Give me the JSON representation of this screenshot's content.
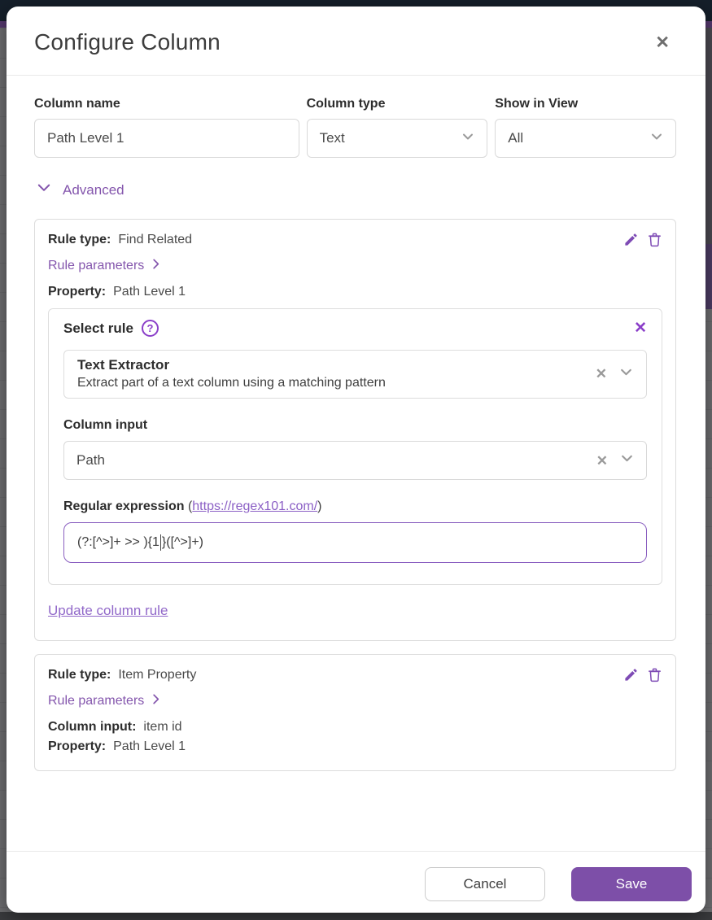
{
  "modal": {
    "title": "Configure Column"
  },
  "icons": {
    "close": "✕",
    "clear": "✕",
    "help": "?"
  },
  "fields": {
    "column_name": {
      "label": "Column name",
      "value": "Path Level 1"
    },
    "column_type": {
      "label": "Column type",
      "value": "Text"
    },
    "show_in_view": {
      "label": "Show in View",
      "value": "All"
    }
  },
  "advanced": {
    "label": "Advanced"
  },
  "rules": [
    {
      "rule_type_label": "Rule type:",
      "rule_type_value": "Find Related",
      "rule_parameters_label": "Rule parameters",
      "property_label": "Property:",
      "property_value": "Path Level 1"
    },
    {
      "rule_type_label": "Rule type:",
      "rule_type_value": "Item Property",
      "rule_parameters_label": "Rule parameters",
      "column_input_label": "Column input:",
      "column_input_value": "item id",
      "property_label": "Property:",
      "property_value": "Path Level 1"
    }
  ],
  "rule_editor": {
    "title": "Select rule",
    "selected_rule": {
      "name": "Text Extractor",
      "description": "Extract part of a text column using a matching pattern"
    },
    "column_input": {
      "label": "Column input",
      "value": "Path"
    },
    "regex": {
      "label": "Regular expression",
      "link_prefix": "(",
      "link": "https://regex101.com/",
      "link_suffix": ")",
      "value_before_caret": "(?:[^>]+ >> ){1",
      "value_after_caret": "}([^>]+)"
    },
    "update_link": "Update column rule"
  },
  "footer": {
    "cancel": "Cancel",
    "save": "Save"
  },
  "colors": {
    "accent_purple": "#7d4fa8",
    "link_purple": "#8b5fc5",
    "icon_purple": "#7e4bb5",
    "backdrop_navy": "#151f2a"
  }
}
